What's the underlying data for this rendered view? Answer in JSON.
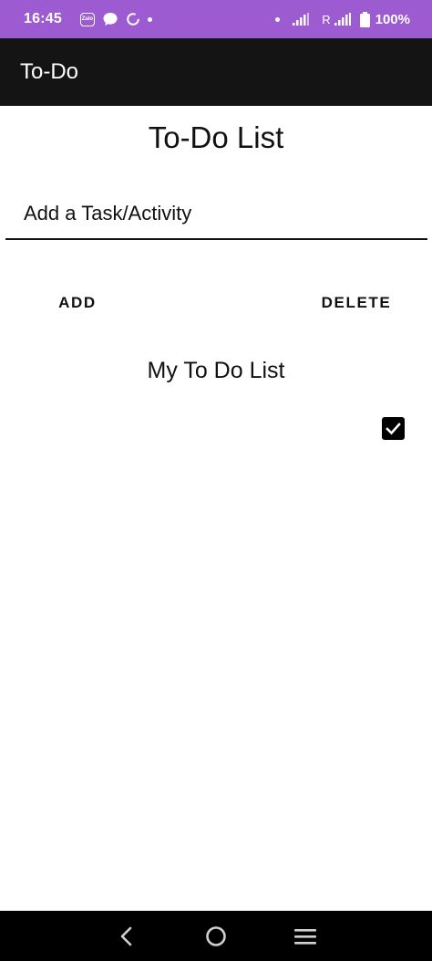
{
  "status_bar": {
    "time": "16:45",
    "icons_left": [
      "zalo-icon",
      "chat-bubble-icon",
      "sync-icon",
      "dot-icon"
    ],
    "zalo_text": "Zalo",
    "icons_right": [
      "dot-icon",
      "signal-icon",
      "roaming-signal-icon",
      "battery-icon"
    ],
    "roaming_label": "R",
    "battery": "100%",
    "background_color": "#9c5bd0"
  },
  "app_bar": {
    "title": "To-Do",
    "background_color": "#141414"
  },
  "main": {
    "heading": "To-Do List",
    "task_input": {
      "placeholder": "Add a Task/Activity",
      "value": ""
    },
    "add_button_label": "ADD",
    "delete_button_label": "DELETE",
    "list_heading": "My To Do List",
    "items": [
      {
        "label": "",
        "checked": true
      }
    ]
  },
  "nav_bar": {
    "buttons": [
      "back-icon",
      "home-icon",
      "recents-icon"
    ]
  }
}
